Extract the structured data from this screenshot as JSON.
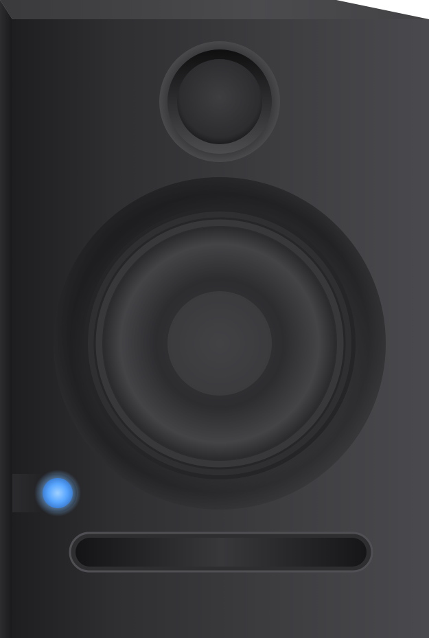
{
  "illustration": {
    "subject_icon": "studio-monitor-speaker-icon",
    "colors": {
      "cabinet_dark": "#1c1c1e",
      "cabinet_mid": "#3a3a3d",
      "cabinet_light": "#4a4a4e",
      "top_face": "#444447",
      "cone": "#3f3f42",
      "dust_cap": "#404043",
      "power_led": "#5aa7ff",
      "power_led_glow": "#9fd0ff"
    },
    "parts": {
      "tweeter": "tweeter-icon",
      "woofer": "woofer-icon",
      "power_indicator": "power-led-icon",
      "bass_port": "bass-port-icon"
    },
    "power_on": true
  }
}
